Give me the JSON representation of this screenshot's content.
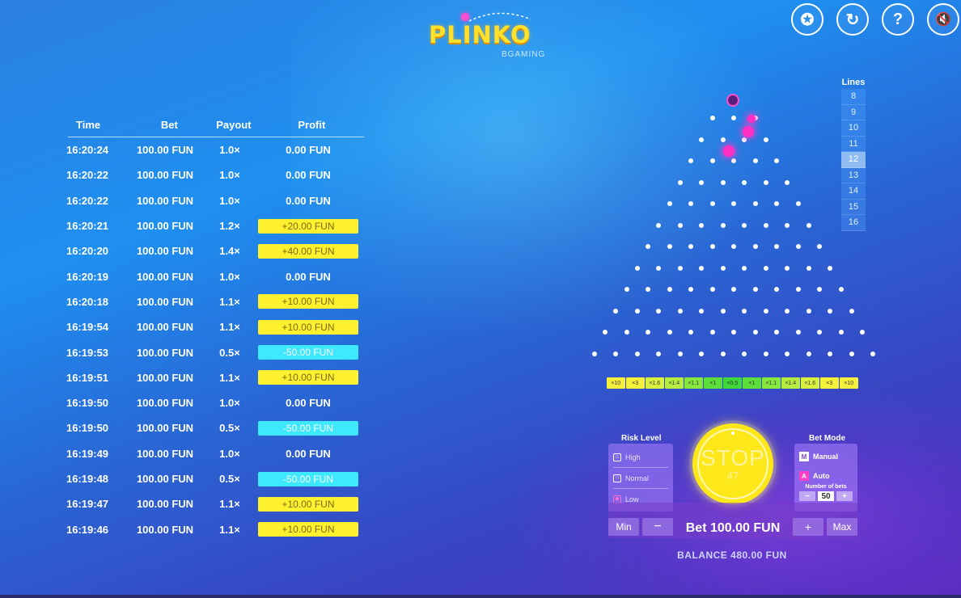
{
  "logo": {
    "title": "PLINKO",
    "sub": "BGAMING"
  },
  "top_buttons": [
    {
      "name": "achievements-icon",
      "glyph": "✪"
    },
    {
      "name": "history-icon",
      "glyph": "↻"
    },
    {
      "name": "help-icon",
      "glyph": "?"
    },
    {
      "name": "mute-icon",
      "glyph": "🔇"
    }
  ],
  "history": {
    "headers": {
      "time": "Time",
      "bet": "Bet",
      "payout": "Payout",
      "profit": "Profit"
    },
    "rows": [
      {
        "time": "16:20:24",
        "bet": "100.00 FUN",
        "payout": "1.0×",
        "profit": "0.00 FUN",
        "kind": "zero"
      },
      {
        "time": "16:20:22",
        "bet": "100.00 FUN",
        "payout": "1.0×",
        "profit": "0.00 FUN",
        "kind": "zero"
      },
      {
        "time": "16:20:22",
        "bet": "100.00 FUN",
        "payout": "1.0×",
        "profit": "0.00 FUN",
        "kind": "zero"
      },
      {
        "time": "16:20:21",
        "bet": "100.00 FUN",
        "payout": "1.2×",
        "profit": "+20.00 FUN",
        "kind": "pos"
      },
      {
        "time": "16:20:20",
        "bet": "100.00 FUN",
        "payout": "1.4×",
        "profit": "+40.00 FUN",
        "kind": "pos"
      },
      {
        "time": "16:20:19",
        "bet": "100.00 FUN",
        "payout": "1.0×",
        "profit": "0.00 FUN",
        "kind": "zero"
      },
      {
        "time": "16:20:18",
        "bet": "100.00 FUN",
        "payout": "1.1×",
        "profit": "+10.00 FUN",
        "kind": "pos"
      },
      {
        "time": "16:19:54",
        "bet": "100.00 FUN",
        "payout": "1.1×",
        "profit": "+10.00 FUN",
        "kind": "pos"
      },
      {
        "time": "16:19:53",
        "bet": "100.00 FUN",
        "payout": "0.5×",
        "profit": "-50.00 FUN",
        "kind": "neg"
      },
      {
        "time": "16:19:51",
        "bet": "100.00 FUN",
        "payout": "1.1×",
        "profit": "+10.00 FUN",
        "kind": "pos"
      },
      {
        "time": "16:19:50",
        "bet": "100.00 FUN",
        "payout": "1.0×",
        "profit": "0.00 FUN",
        "kind": "zero"
      },
      {
        "time": "16:19:50",
        "bet": "100.00 FUN",
        "payout": "0.5×",
        "profit": "-50.00 FUN",
        "kind": "neg"
      },
      {
        "time": "16:19:49",
        "bet": "100.00 FUN",
        "payout": "1.0×",
        "profit": "0.00 FUN",
        "kind": "zero"
      },
      {
        "time": "16:19:48",
        "bet": "100.00 FUN",
        "payout": "0.5×",
        "profit": "-50.00 FUN",
        "kind": "neg"
      },
      {
        "time": "16:19:47",
        "bet": "100.00 FUN",
        "payout": "1.1×",
        "profit": "+10.00 FUN",
        "kind": "pos"
      },
      {
        "time": "16:19:46",
        "bet": "100.00 FUN",
        "payout": "1.1×",
        "profit": "+10.00 FUN",
        "kind": "pos"
      }
    ]
  },
  "board": {
    "rows": 12
  },
  "multipliers": [
    {
      "label": "×10",
      "color": "#f5f03a"
    },
    {
      "label": "×3",
      "color": "#f5f03a"
    },
    {
      "label": "×1.6",
      "color": "#d8f040"
    },
    {
      "label": "×1.4",
      "color": "#b6ec40"
    },
    {
      "label": "×1.1",
      "color": "#86e83c"
    },
    {
      "label": "×1",
      "color": "#5cdf3a"
    },
    {
      "label": "×0.5",
      "color": "#3ed83a"
    },
    {
      "label": "×1",
      "color": "#5cdf3a"
    },
    {
      "label": "×1.1",
      "color": "#86e83c"
    },
    {
      "label": "×1.4",
      "color": "#b6ec40"
    },
    {
      "label": "×1.6",
      "color": "#d8f040"
    },
    {
      "label": "×3",
      "color": "#f5f03a"
    },
    {
      "label": "×10",
      "color": "#f5f03a"
    }
  ],
  "lines": {
    "title": "Lines",
    "options": [
      "8",
      "9",
      "10",
      "11",
      "12",
      "13",
      "14",
      "15",
      "16"
    ],
    "selected": "12"
  },
  "risk": {
    "title": "Risk Level",
    "options": [
      {
        "label": "High",
        "icon": "flame-icon"
      },
      {
        "label": "Normal",
        "icon": "circle-icon"
      },
      {
        "label": "Low",
        "icon": "drop-icon"
      }
    ]
  },
  "mode": {
    "title": "Bet Mode",
    "manual": "Manual",
    "manual_key": "M",
    "auto": "Auto",
    "auto_key": "A",
    "number_of_bets_label": "Number of bets",
    "number_of_bets": "50",
    "minus": "−",
    "plus": "+"
  },
  "stop": {
    "label": "STOP",
    "count": "47"
  },
  "bet": {
    "min": "Min",
    "minus": "−",
    "amount": "Bet 100.00 FUN",
    "plus": "+",
    "max": "Max"
  },
  "balance": "BALANCE 480.00 FUN"
}
